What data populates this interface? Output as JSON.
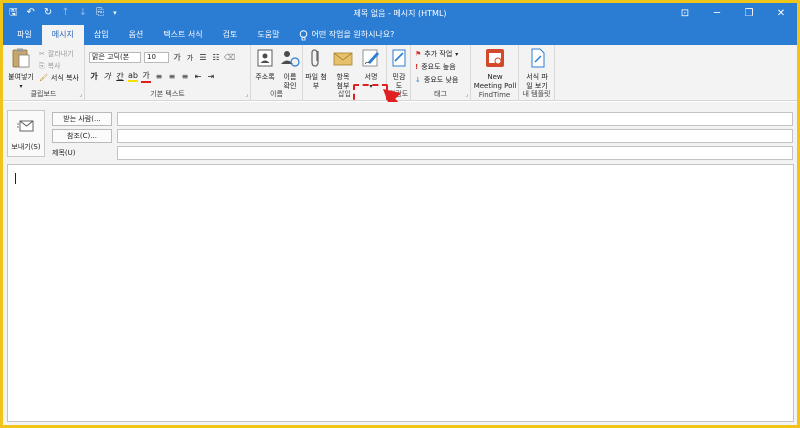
{
  "window": {
    "title": "제목 없음  -  메시지 (HTML)",
    "controls": [
      "⊡",
      "─",
      "❐",
      "✕"
    ]
  },
  "qat": {
    "save": "🖫",
    "undo": "↶",
    "redo": "↻",
    "up": "↑",
    "down": "↓",
    "addon": "⎘",
    "more": "▾"
  },
  "tabs": [
    {
      "label": "파일"
    },
    {
      "label": "메시지"
    },
    {
      "label": "삽입"
    },
    {
      "label": "옵션"
    },
    {
      "label": "텍스트 서식"
    },
    {
      "label": "검토"
    },
    {
      "label": "도움말"
    }
  ],
  "tell_me": "어떤 작업을 원하시나요?",
  "ribbon": {
    "clipboard": {
      "paste": "붙여넣기",
      "cut": "잘라내기",
      "copy": "복사",
      "format_painter": "서식 복사",
      "label": "클립보드"
    },
    "basic_text": {
      "font": "맑은 고딕(본",
      "size": "10",
      "grow": "가",
      "shrink": "가",
      "bold": "가",
      "italic": "가",
      "underline": "간",
      "label": "기본 텍스트"
    },
    "names": {
      "address_book": "주소록",
      "check_names_1": "이름",
      "check_names_2": "확인",
      "label": "이름"
    },
    "insert": {
      "attach_file_1": "파일 첨",
      "attach_file_2": "부",
      "attach_item_1": "항목",
      "attach_item_2": "첨부",
      "signature": "서명",
      "label": "삽입"
    },
    "sensitivity": {
      "label_1": "민감",
      "label_2": "도",
      "group": "민감도"
    },
    "tags": {
      "follow_up": "추가 작업",
      "high": "중요도 높음",
      "low": "중요도 낮음",
      "label": "태그"
    },
    "findtime": {
      "new_1": "New",
      "new_2": "Meeting Poll",
      "label": "FindTime"
    },
    "templates": {
      "view_1": "서식 파",
      "view_2": "일 보기",
      "label": "내 템플릿"
    }
  },
  "compose": {
    "send": "보내기(S)",
    "to": "받는 사람(...",
    "cc": "참조(C)...",
    "subject_label": "제목(U)",
    "to_value": "",
    "cc_value": "",
    "subject_value": ""
  },
  "colors": {
    "accent": "#2b7cd3",
    "highlight": "#e02020",
    "border": "#f0c419"
  }
}
